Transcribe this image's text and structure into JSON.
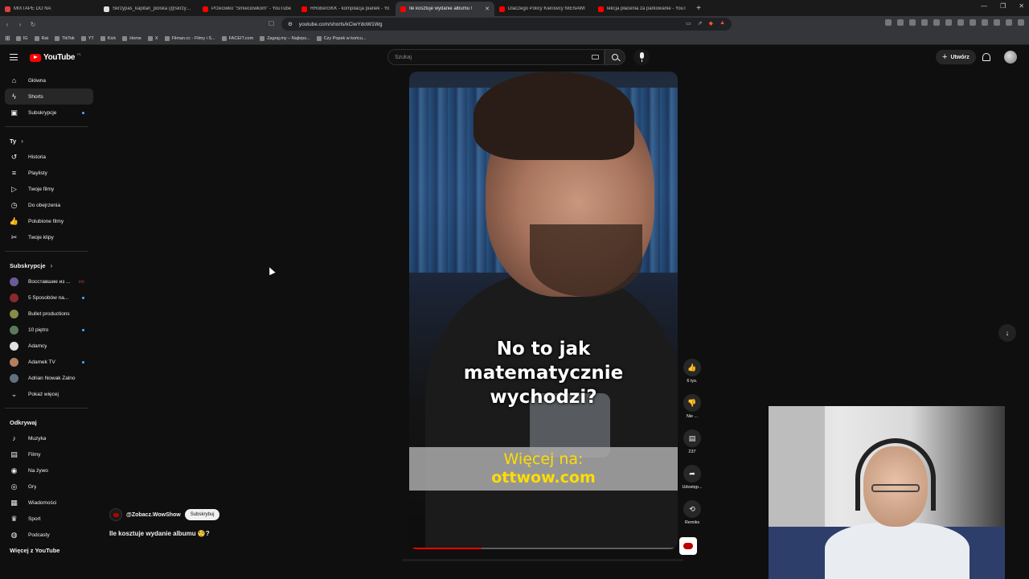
{
  "browser": {
    "tabs": [
      {
        "title": "MIXTAPE DO NA",
        "color": "#e04040",
        "active": false
      },
      {
        "title": "Skrzypas_kapitan_polska (@skrzypas",
        "color": "#e0e0e0",
        "active": false
      },
      {
        "title": "Przeciwko \"Śmieciówkom\" - YouTube",
        "color": "#ff0000",
        "active": false
      },
      {
        "title": "RRobercIKK - kompilacja pianek - Yo",
        "color": "#ff0000",
        "active": false
      },
      {
        "title": "Ile kosztuje wydanie albumu !",
        "color": "#ff0000",
        "active": true
      },
      {
        "title": "Dlaczego Policy Kierowcy NIENAWI",
        "color": "#ff0000",
        "active": false
      },
      {
        "title": "lekcja płacenia za parkowanie - YouT",
        "color": "#ff0000",
        "active": false
      }
    ],
    "new_tab": "+",
    "url": "youtube.com/shorts/kCiwYdoW1Wg",
    "bookmarks": [
      "IG",
      "Rat",
      "TikTok",
      "YT",
      "Kick",
      "Home",
      "X",
      "Filman.cc - Filmy i S...",
      "FACEIT.com",
      "Zagraj.my – Najleps...",
      "Czy Popek w końcu..."
    ]
  },
  "header": {
    "logo_text": "YouTube",
    "region": "PL",
    "search_placeholder": "Szukaj",
    "create_label": "Utwórz"
  },
  "sidebar": {
    "main": [
      {
        "label": "Główna",
        "icon": "home-icon",
        "glyph": "⌂",
        "active": false
      },
      {
        "label": "Shorts",
        "icon": "shorts-icon",
        "glyph": "ϟ",
        "active": true
      },
      {
        "label": "Subskrypcje",
        "icon": "subscriptions-icon",
        "glyph": "▣",
        "active": false,
        "dot": true
      }
    ],
    "you_label": "Ty",
    "you": [
      {
        "label": "Historia",
        "icon": "history-icon",
        "glyph": "↺"
      },
      {
        "label": "Playlisty",
        "icon": "playlists-icon",
        "glyph": "≡"
      },
      {
        "label": "Twoje filmy",
        "icon": "your-videos-icon",
        "glyph": "▷"
      },
      {
        "label": "Do obejrzenia",
        "icon": "watch-later-icon",
        "glyph": "◷"
      },
      {
        "label": "Polubione filmy",
        "icon": "liked-icon",
        "glyph": "👍"
      },
      {
        "label": "Twoje klipy",
        "icon": "clips-icon",
        "glyph": "✂"
      }
    ],
    "subs_label": "Subskrypcje",
    "subs": [
      {
        "label": "Восставшие из ...",
        "color": "#6a5a9a",
        "marker": "live"
      },
      {
        "label": "5 Sposobów na...",
        "color": "#8a2a2a",
        "marker": "dot"
      },
      {
        "label": "Bullet productions",
        "color": "#8a8a4a",
        "marker": ""
      },
      {
        "label": "10 piętro",
        "color": "#5a7a5a",
        "marker": "dot"
      },
      {
        "label": "Adamcy",
        "color": "#e0e0e0",
        "marker": ""
      },
      {
        "label": "Adamek TV",
        "color": "#b08060",
        "marker": "dot"
      },
      {
        "label": "Adrian Nowak Zalno",
        "color": "#607080",
        "marker": ""
      }
    ],
    "show_more": "Pokaż więcej",
    "explore_label": "Odkrywaj",
    "explore": [
      {
        "label": "Muzyka",
        "icon": "music-icon",
        "glyph": "♪"
      },
      {
        "label": "Filmy",
        "icon": "movies-icon",
        "glyph": "▤"
      },
      {
        "label": "Na żywo",
        "icon": "live-icon",
        "glyph": "◉"
      },
      {
        "label": "Gry",
        "icon": "gaming-icon",
        "glyph": "◎"
      },
      {
        "label": "Wiadomości",
        "icon": "news-icon",
        "glyph": "▦"
      },
      {
        "label": "Sport",
        "icon": "sport-icon",
        "glyph": "♛"
      },
      {
        "label": "Podcasty",
        "icon": "podcast-icon",
        "glyph": "◍"
      }
    ],
    "more_from_yt": "Więcej z YouTube"
  },
  "short": {
    "caption_lines": [
      "No to jak",
      "matematycznie",
      "wychodzi?"
    ],
    "promo_line1": "Więcej na:",
    "promo_line2": "ottwow.com",
    "progress": 0.27
  },
  "actions": {
    "like_count": "6 tys.",
    "dislike_label": "Nie ...",
    "comment_count": "237",
    "share_label": "Udostęp...",
    "remix_label": "Remiks"
  },
  "channel": {
    "handle": "@Zobacz.WowShow",
    "subscribe_label": "Subskrybuj"
  },
  "video_title": "Ile kosztuje wydanie albumu 🧐?"
}
